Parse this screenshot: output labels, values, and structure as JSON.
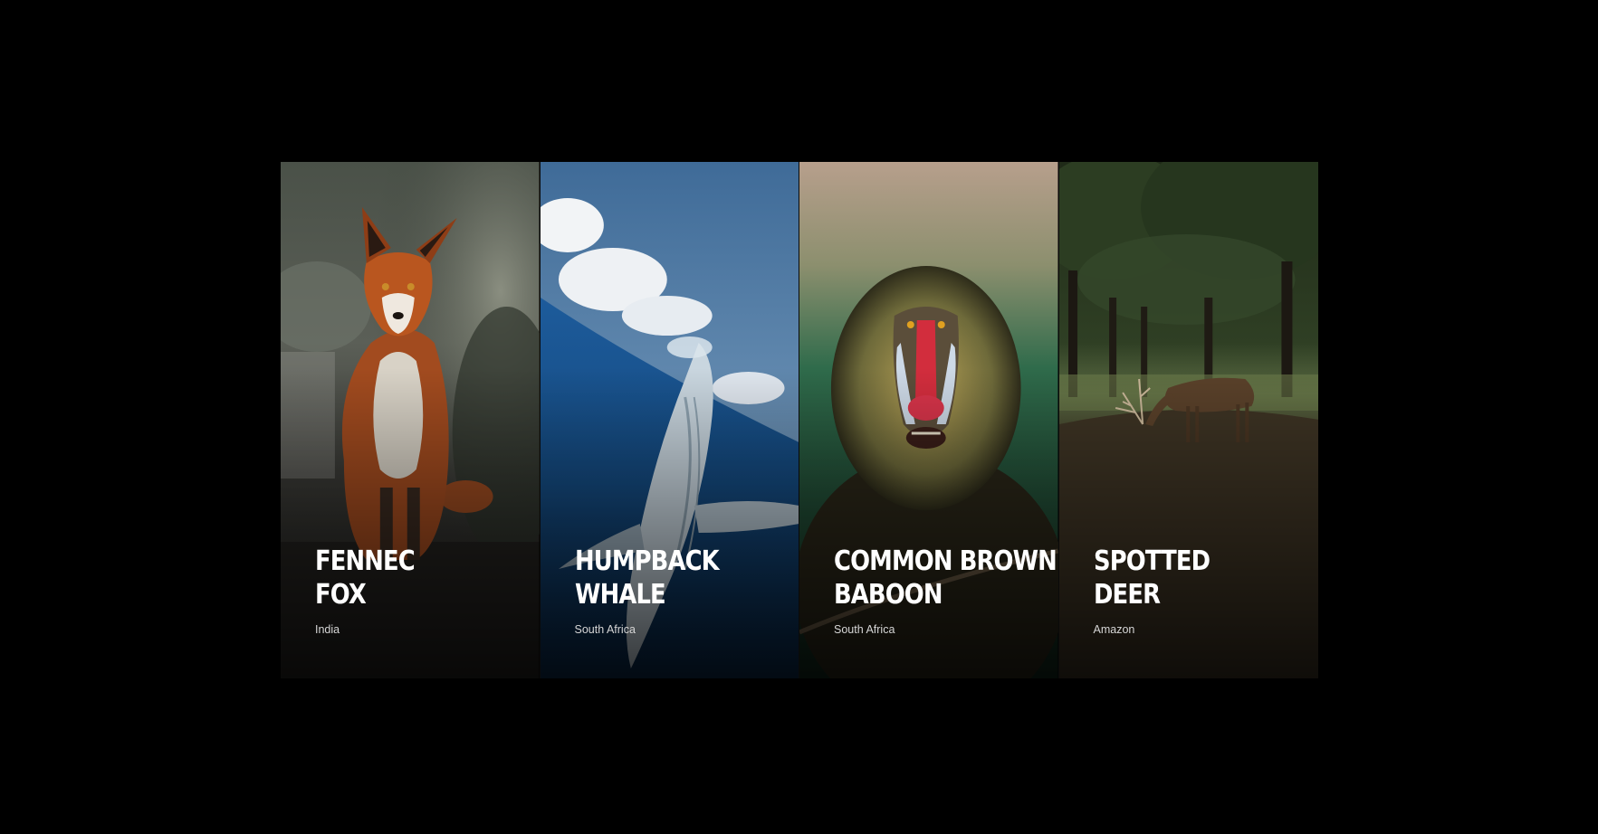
{
  "cards": [
    {
      "title_line1": "FENNEC",
      "title_line2": "FOX",
      "location": "India",
      "image": "red-fox-sitting-photo"
    },
    {
      "title_line1": "HUMPBACK",
      "title_line2": "WHALE",
      "location": "South Africa",
      "image": "humpback-whale-breaching-photo"
    },
    {
      "title_line1": "COMMON BROWN",
      "title_line2": "BABOON",
      "location": "South Africa",
      "image": "mandrill-portrait-photo"
    },
    {
      "title_line1": "SPOTTED",
      "title_line2": "DEER",
      "location": "Amazon",
      "image": "deer-in-forest-photo"
    }
  ],
  "colors": {
    "background": "#000000",
    "title": "#ffffff",
    "location": "#d6d6d6"
  }
}
